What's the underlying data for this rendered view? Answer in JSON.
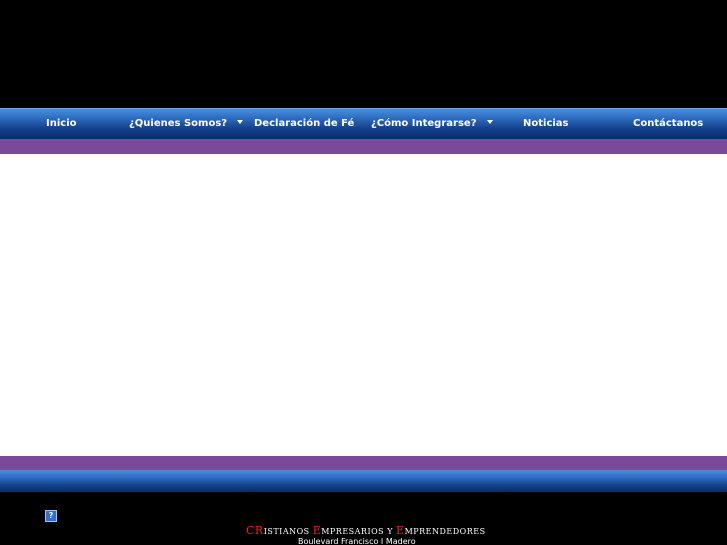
{
  "nav": {
    "items": [
      {
        "label": "Inicio",
        "has_dropdown": false
      },
      {
        "label": "¿Quienes Somos?",
        "has_dropdown": true
      },
      {
        "label": "Declaración de Fé",
        "has_dropdown": false
      },
      {
        "label": "¿Cómo Integrarse?",
        "has_dropdown": true
      },
      {
        "label": "Noticias",
        "has_dropdown": false
      },
      {
        "label": "Contáctanos",
        "has_dropdown": false
      }
    ]
  },
  "footer": {
    "help_icon_glyph": "?",
    "org_name_parts": [
      {
        "cap": "CR",
        "rest": "istianos "
      },
      {
        "cap": "E",
        "rest": "mpresarios y "
      },
      {
        "cap": "E",
        "rest": "mprendedores"
      }
    ],
    "address": "Boulevard Francisco I Madero"
  },
  "colors": {
    "nav_blue": "#2d6cc0",
    "purple_band": "#7a4a9a",
    "accent_red": "#ff1a1a",
    "background": "#000000",
    "content": "#ffffff"
  }
}
